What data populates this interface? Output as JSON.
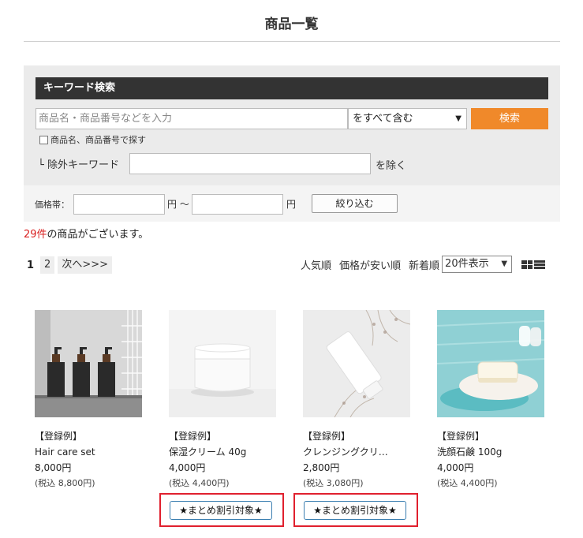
{
  "page": {
    "title": "商品一覧"
  },
  "search": {
    "heading": "キーワード検索",
    "placeholder": "商品名・商品番号などを入力",
    "mode_selected": "をすべて含む",
    "submit_label": "検索",
    "checkbox_label": "商品名、商品番号で探す",
    "exclude_label": "└ 除外キーワード",
    "exclude_suffix": "を除く"
  },
  "price_filter": {
    "label": "価格帯：",
    "min_unit": "円 ～",
    "max_unit": "円",
    "button_label": "絞り込む"
  },
  "results": {
    "count": "29件",
    "suffix": "の商品がございます。"
  },
  "pagination": {
    "current": "1",
    "page2": "2",
    "next": "次へ>>>"
  },
  "sort": {
    "popular": "人気順",
    "cheapest": "価格が安い順",
    "newest": "新着順",
    "per_page_selected": "20件表示"
  },
  "products": [
    {
      "tag": "【登録例】",
      "name": "Hair care set",
      "price": "8,000円",
      "taxed": "(税込 8,800円)",
      "badge": ""
    },
    {
      "tag": "【登録例】",
      "name": "保湿クリーム 40g",
      "price": "4,000円",
      "taxed": "(税込 4,400円)",
      "badge": "★まとめ割引対象★"
    },
    {
      "tag": "【登録例】",
      "name": "クレンジングクリ…",
      "price": "2,800円",
      "taxed": "(税込 3,080円)",
      "badge": "★まとめ割引対象★"
    },
    {
      "tag": "【登録例】",
      "name": "洗顔石鹸 100g",
      "price": "4,000円",
      "taxed": "(税込 4,400円)",
      "badge": ""
    }
  ],
  "icons": {
    "select_caret": "▼",
    "grid_view": "grid-view-icon",
    "list_view": "list-view-icon"
  },
  "colors": {
    "accent": "#f0892a",
    "count": "#d92020",
    "highlight": "#e0202e",
    "badge_border": "#3c7fb1",
    "header": "#333333"
  }
}
